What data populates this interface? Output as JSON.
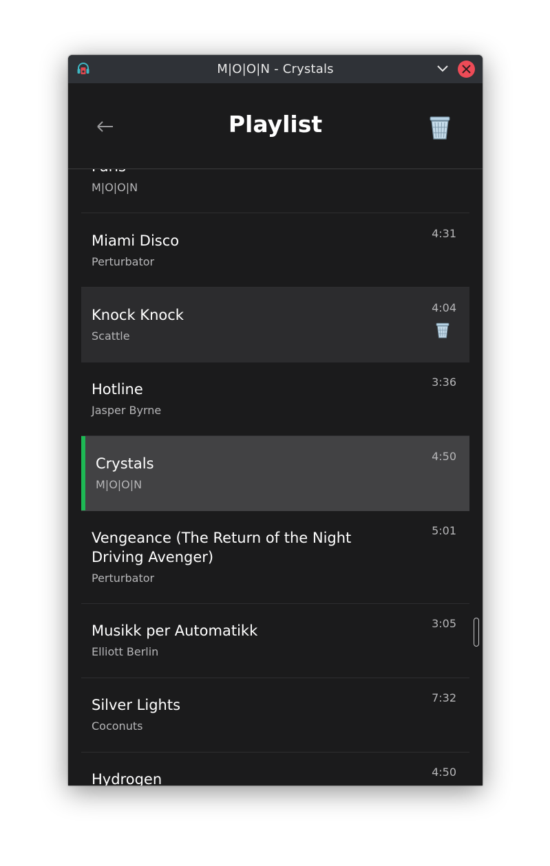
{
  "window": {
    "title": "M|O|O|N - Crystals",
    "app_icon": "headphones-music-icon",
    "minimize_icon": "chevron-down-icon",
    "close_icon": "close-icon",
    "close_color": "#ed4b57"
  },
  "header": {
    "back_icon": "arrow-left-icon",
    "title": "Playlist",
    "clear_icon": "trash-icon"
  },
  "accent_color": "#1db954",
  "playlist": [
    {
      "title": "Paris",
      "artist": "M|O|O|N",
      "duration": "",
      "state": "normal"
    },
    {
      "title": "Miami Disco",
      "artist": "Perturbator",
      "duration": "4:31",
      "state": "normal"
    },
    {
      "title": "Knock Knock",
      "artist": "Scattle",
      "duration": "4:04",
      "state": "hover"
    },
    {
      "title": "Hotline",
      "artist": "Jasper Byrne",
      "duration": "3:36",
      "state": "normal"
    },
    {
      "title": "Crystals",
      "artist": "M|O|O|N",
      "duration": "4:50",
      "state": "current"
    },
    {
      "title": "Vengeance (The Return of the Night Driving Avenger)",
      "artist": "Perturbator",
      "duration": "5:01",
      "state": "normal"
    },
    {
      "title": "Musikk per Automatikk",
      "artist": "Elliott Berlin",
      "duration": "3:05",
      "state": "normal"
    },
    {
      "title": "Silver Lights",
      "artist": "Coconuts",
      "duration": "7:32",
      "state": "normal"
    },
    {
      "title": "Hydrogen",
      "artist": "",
      "duration": "4:50",
      "state": "normal"
    }
  ]
}
